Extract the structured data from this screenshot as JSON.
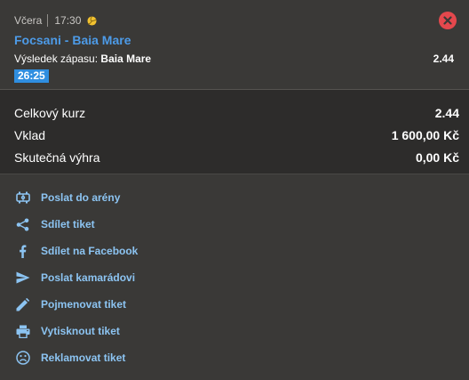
{
  "bet": {
    "day": "Včera",
    "time": "17:30",
    "sport_icon": "volleyball-icon",
    "match": "Focsani - Baia Mare",
    "market_label": "Výsledek zápasu:",
    "selection": "Baia Mare",
    "odd": "2.44",
    "live_time": "26:25",
    "close_icon": "close-icon"
  },
  "summary": {
    "rows": [
      {
        "label": "Celkový kurz",
        "value": "2.44"
      },
      {
        "label": "Vklad",
        "value": "1 600,00 Kč"
      },
      {
        "label": "Skutečná výhra",
        "value": "0,00 Kč"
      }
    ]
  },
  "actions": [
    {
      "label": "Poslat do arény",
      "icon": "arena-icon"
    },
    {
      "label": "Sdílet tiket",
      "icon": "share-icon"
    },
    {
      "label": "Sdílet na Facebook",
      "icon": "facebook-icon"
    },
    {
      "label": "Poslat kamarádovi",
      "icon": "send-icon"
    },
    {
      "label": "Pojmenovat tiket",
      "icon": "pencil-icon"
    },
    {
      "label": "Vytisknout tiket",
      "icon": "printer-icon"
    },
    {
      "label": "Reklamovat tiket",
      "icon": "sad-face-icon"
    }
  ],
  "colors": {
    "accent": "#4d9be8",
    "link": "#8cc4f2",
    "close": "#e5484d",
    "live_badge": "#2f8ee0",
    "ball": "#f2c230"
  }
}
